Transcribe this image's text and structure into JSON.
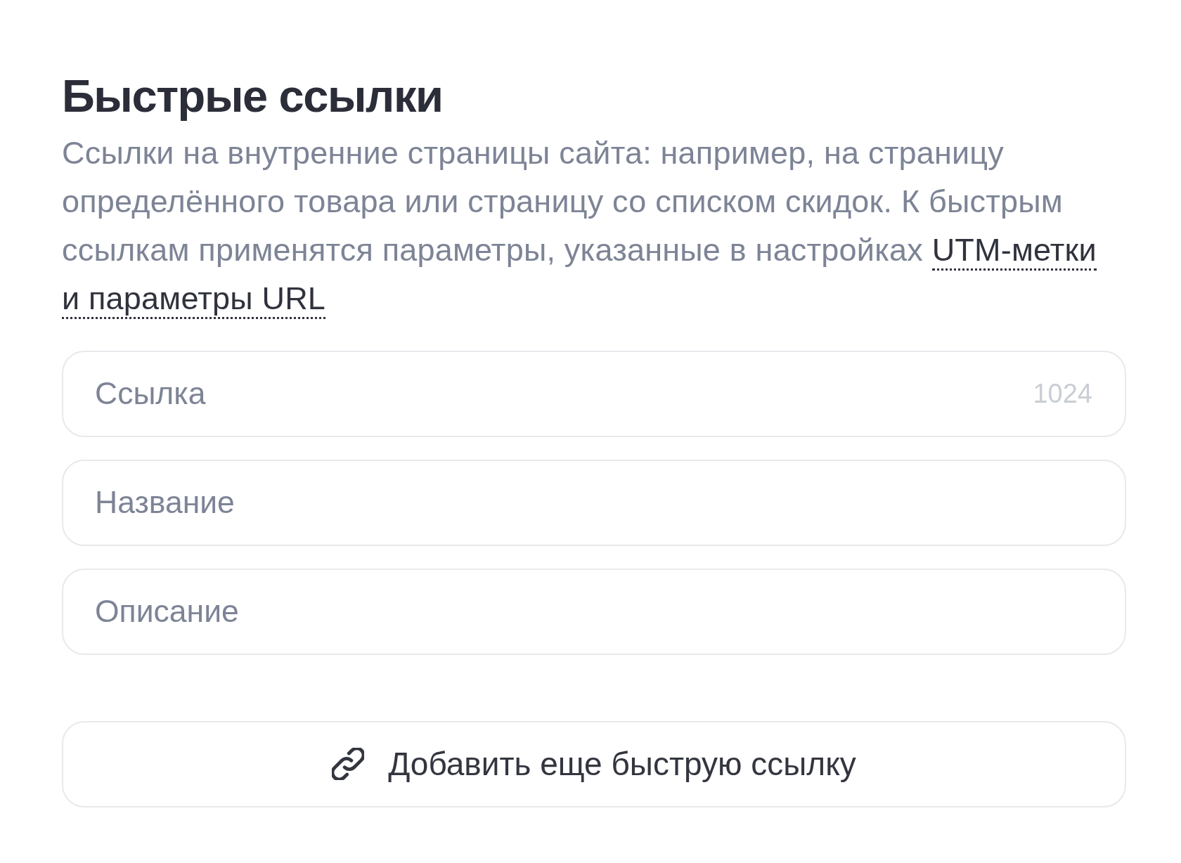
{
  "title": "Быстрые ссылки",
  "description": {
    "text": "Ссылки на внутренние страницы сайта: например, на страницу определённого товара или страницу со списком скидок. К быстрым ссылкам применятся параметры, указанные в настройках",
    "link_parts": [
      "UTM-метки",
      "и параметры URL"
    ]
  },
  "fields": [
    {
      "placeholder": "Ссылка",
      "counter": "1024"
    },
    {
      "placeholder": "Название"
    },
    {
      "placeholder": "Описание"
    }
  ],
  "add_button": {
    "label": "Добавить еще быструю ссылку"
  }
}
